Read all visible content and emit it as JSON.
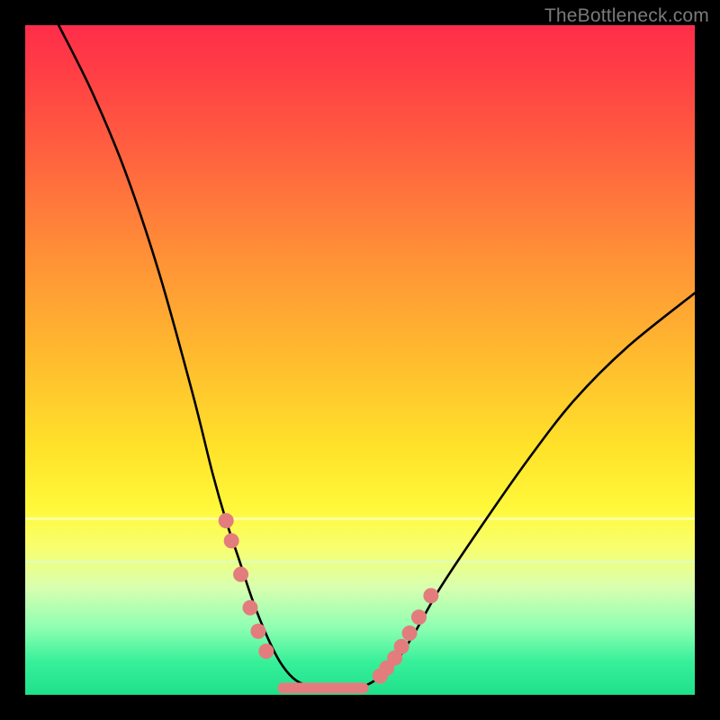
{
  "watermark": "TheBottleneck.com",
  "colors": {
    "frame": "#000000",
    "watermark": "#7a7a7a",
    "curve": "#000000",
    "marker": "#e37d7d"
  },
  "chart_data": {
    "type": "line",
    "title": "",
    "xlabel": "",
    "ylabel": "",
    "xlim": [
      0,
      100
    ],
    "ylim": [
      0,
      100
    ],
    "grid": false,
    "legend": false,
    "series": [
      {
        "name": "bottleneck-curve",
        "x": [
          5,
          10,
          15,
          20,
          25,
          28,
          30,
          32,
          34,
          36,
          38,
          40,
          42,
          44,
          46,
          48,
          50,
          52,
          55,
          58,
          62,
          68,
          75,
          82,
          90,
          100
        ],
        "y": [
          100,
          90,
          78,
          63,
          45,
          33,
          26,
          20,
          14,
          9,
          5,
          2.5,
          1.4,
          1.0,
          1.0,
          1.0,
          1.2,
          2.0,
          4.5,
          9,
          16,
          25,
          35,
          44,
          52,
          60
        ]
      }
    ],
    "markers": {
      "left_cluster_x": [
        30.0,
        30.8,
        32.2,
        33.6,
        34.8,
        36.0
      ],
      "left_cluster_y": [
        26,
        23,
        18,
        13,
        9.5,
        6.5
      ],
      "right_cluster_x": [
        53.0,
        54.0,
        55.2,
        56.2,
        57.4,
        58.8,
        60.6
      ],
      "right_cluster_y": [
        2.8,
        4.0,
        5.5,
        7.2,
        9.2,
        11.6,
        14.8
      ],
      "floor_segment": {
        "x0": 38.5,
        "x1": 50.5,
        "y": 1.0
      }
    }
  }
}
